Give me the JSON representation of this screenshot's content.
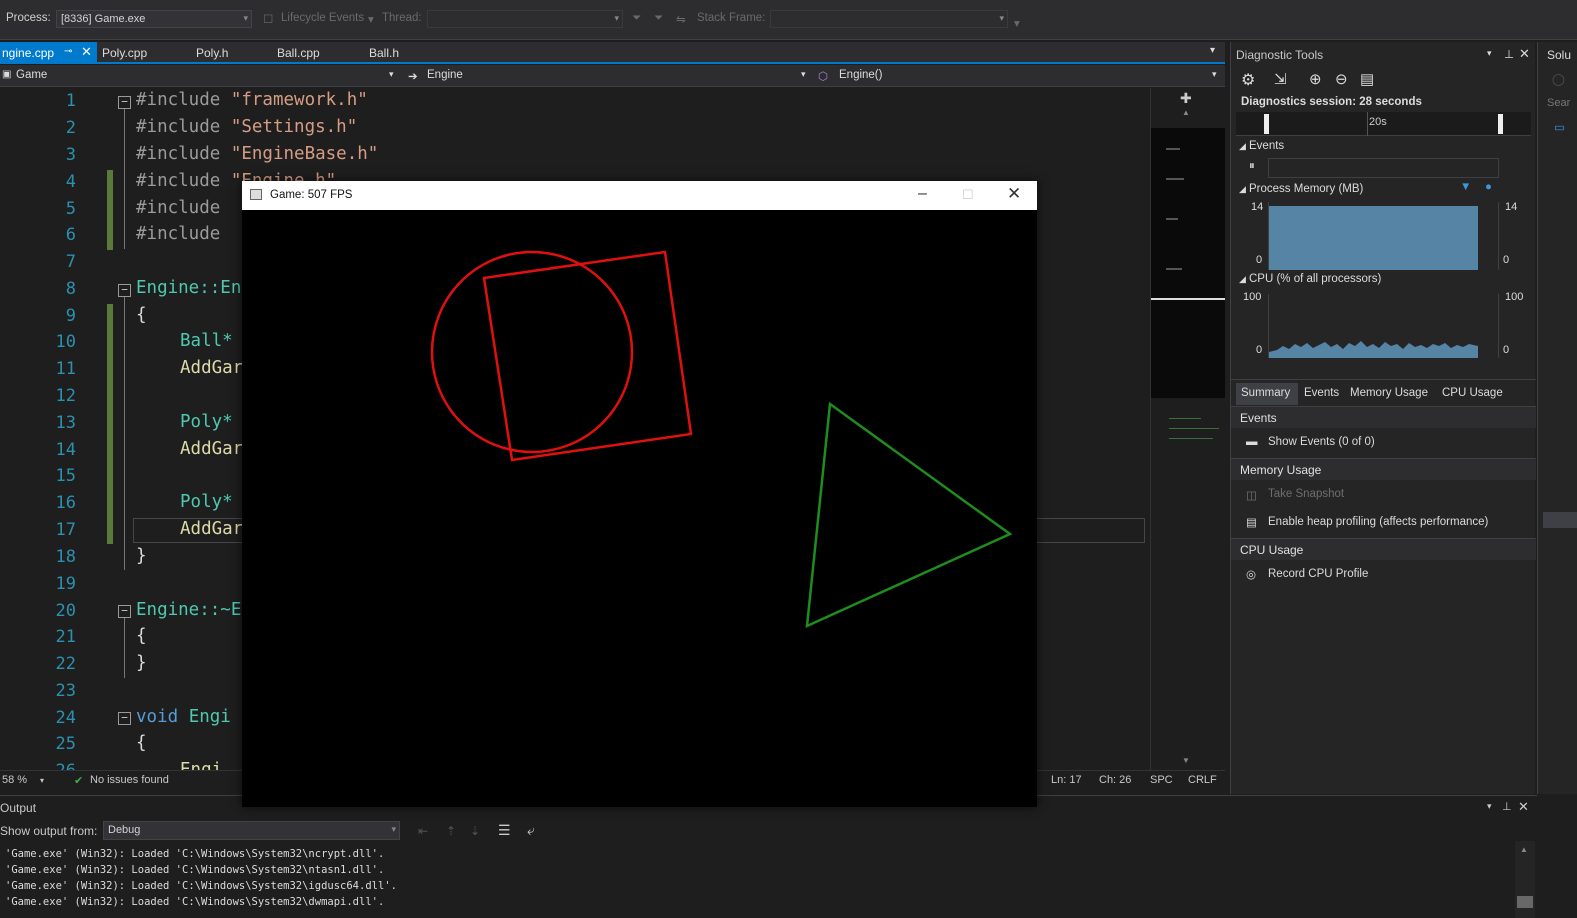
{
  "toolbar": {
    "process_label": "Process:",
    "process_value": "[8336] Game.exe",
    "lifecycle_label": "Lifecycle Events",
    "thread_label": "Thread:",
    "stack_frame_label": "Stack Frame:"
  },
  "tabs": [
    "ngine.cpp",
    "Poly.cpp",
    "Poly.h",
    "Ball.cpp",
    "Ball.h"
  ],
  "nav": {
    "project": "Game",
    "class": "Engine",
    "member": "Engine()"
  },
  "editor": {
    "line_numbers": [
      "1",
      "2",
      "3",
      "4",
      "5",
      "6",
      "7",
      "8",
      "9",
      "10",
      "11",
      "12",
      "13",
      "14",
      "15",
      "16",
      "17",
      "18",
      "19",
      "20",
      "21",
      "22",
      "23",
      "24",
      "25",
      "26"
    ],
    "lines": {
      "l1_pp": "#include ",
      "l1_str": "\"framework.h\"",
      "l2_pp": "#include ",
      "l2_str": "\"Settings.h\"",
      "l3_pp": "#include ",
      "l3_str": "\"EngineBase.h\"",
      "l4_pp": "#include ",
      "l4_str": "\"Engine.h\"",
      "l5_pp": "#include ",
      "l6_pp": "#include ",
      "l8_typ": "Engine::En",
      "l9": "{",
      "l10_typ": "Ball*",
      "l11_fn": "AddGar",
      "l13_typ": "Poly*",
      "l14_fn": "AddGar",
      "l16_typ": "Poly*",
      "l17_fn": "AddGar",
      "l18": "}",
      "l20_typ": "Engine::~E",
      "l21": "{",
      "l22": "}",
      "l24_kw": "void ",
      "l24_typ": "Engi",
      "l25": "{",
      "l26_fn": "Engi"
    }
  },
  "editor_status": {
    "zoom": "58 %",
    "issues": "No issues found",
    "ln": "Ln: 17",
    "ch": "Ch: 26",
    "spc": "SPC",
    "crlf": "CRLF"
  },
  "game_window": {
    "title": "Game: 507 FPS",
    "shapes": {
      "circle_color": "#e01010",
      "square_color": "#e01010",
      "triangle_color": "#1e8c1e"
    }
  },
  "diagnostics": {
    "title": "Diagnostic Tools",
    "session": "Diagnostics session: 28 seconds",
    "timeline_tick": "20s",
    "events_label": "Events",
    "memory_label": "Process Memory (MB)",
    "memory_max": "14",
    "memory_min": "0",
    "cpu_label": "CPU (% of all processors)",
    "cpu_max": "100",
    "cpu_min": "0",
    "subtabs": [
      "Summary",
      "Events",
      "Memory Usage",
      "CPU Usage"
    ],
    "section_events": "Events",
    "show_events": "Show Events (0 of 0)",
    "section_memory": "Memory Usage",
    "take_snapshot": "Take Snapshot",
    "heap_profiling": "Enable heap profiling (affects performance)",
    "section_cpu": "CPU Usage",
    "record_cpu": "Record CPU Profile"
  },
  "solution": {
    "label": "Solu",
    "search": "Sear"
  },
  "output": {
    "title": "Output",
    "show_from_label": "Show output from:",
    "show_from_value": "Debug",
    "lines": [
      "'Game.exe' (Win32): Loaded 'C:\\Windows\\System32\\ncrypt.dll'.",
      "'Game.exe' (Win32): Loaded 'C:\\Windows\\System32\\ntasn1.dll'.",
      "'Game.exe' (Win32): Loaded 'C:\\Windows\\System32\\igdusc64.dll'.",
      "'Game.exe' (Win32): Loaded 'C:\\Windows\\System32\\dwmapi.dll'."
    ]
  }
}
